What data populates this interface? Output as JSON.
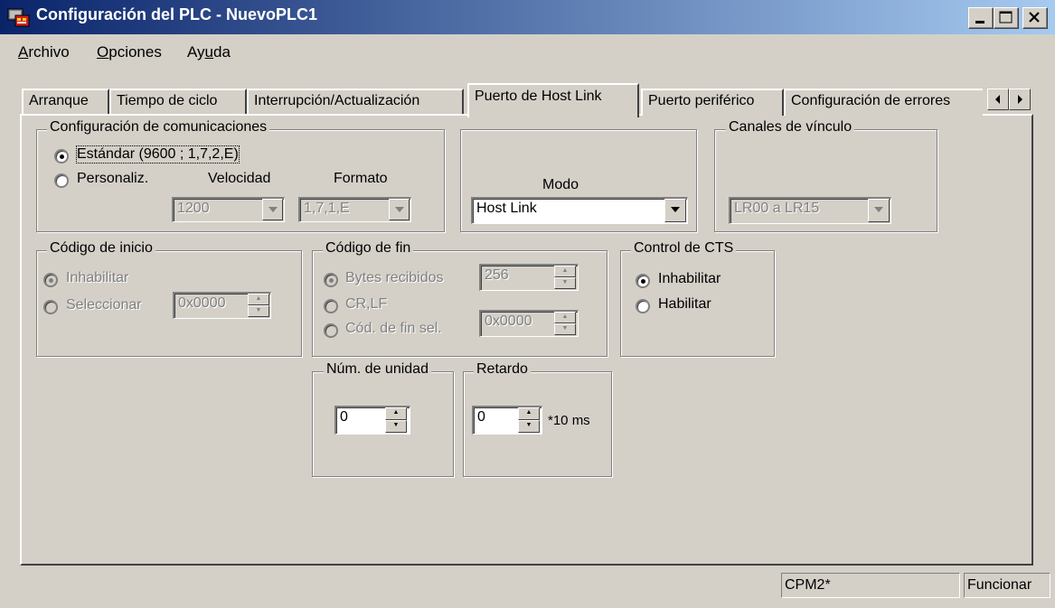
{
  "window": {
    "title": "Configuración del PLC - NuevoPLC1",
    "icon": "plc-app-icon",
    "buttons": {
      "minimize": "_",
      "maximize": "□",
      "close": "×"
    }
  },
  "menu": {
    "items": [
      {
        "mnemonic": "A",
        "rest": "rchivo"
      },
      {
        "mnemonic": "O",
        "rest": "pciones"
      },
      {
        "pre": "Ay",
        "mnemonic": "u",
        "rest": "da"
      }
    ]
  },
  "tabs": [
    {
      "label": "Arranque"
    },
    {
      "label": "Tiempo de ciclo"
    },
    {
      "label": "Interrupción/Actualización"
    },
    {
      "label": "Puerto de Host Link",
      "active": true
    },
    {
      "label": "Puerto periférico"
    },
    {
      "label": "Configuración de errores"
    }
  ],
  "comm": {
    "legend": "Configuración de comunicaciones",
    "standard_label": "Estándar (9600 ; 1,7,2,E)",
    "custom_label": "Personaliz.",
    "speed_label": "Velocidad",
    "format_label": "Formato",
    "speed_value": "1200",
    "format_value": "1,7,1,E"
  },
  "mode": {
    "label": "Modo",
    "value": "Host Link"
  },
  "link": {
    "legend": "Canales de vínculo",
    "value": "LR00 a LR15"
  },
  "start_code": {
    "legend": "Código de inicio",
    "disable_label": "Inhabilitar",
    "select_label": "Seleccionar",
    "value": "0x0000"
  },
  "end_code": {
    "legend": "Código de fin",
    "bytes_label": "Bytes recibidos",
    "bytes_value": "256",
    "crlf_label": "CR,LF",
    "sel_label": "Cód. de fin sel.",
    "sel_value": "0x0000"
  },
  "cts": {
    "legend": "Control de CTS",
    "disable_label": "Inhabilitar",
    "enable_label": "Habilitar"
  },
  "unit": {
    "legend": "Núm. de unidad",
    "value": "0"
  },
  "delay": {
    "legend": "Retardo",
    "value": "0",
    "unit": "*10 ms"
  },
  "status": {
    "model": "CPM2*",
    "mode": "Funcionar"
  }
}
